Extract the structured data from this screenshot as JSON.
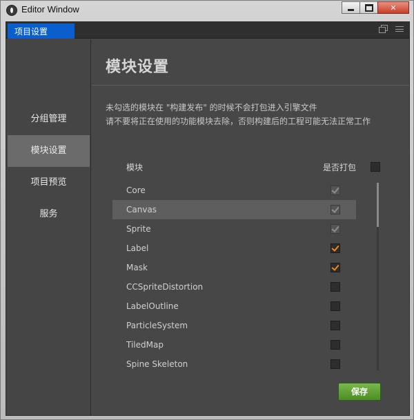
{
  "window": {
    "title": "Editor Window"
  },
  "tabbar": {
    "active_tab": "项目设置"
  },
  "sidebar": {
    "items": [
      {
        "label": "分组管理",
        "active": false
      },
      {
        "label": "模块设置",
        "active": true
      },
      {
        "label": "项目预览",
        "active": false
      },
      {
        "label": "服务",
        "active": false
      }
    ]
  },
  "main": {
    "title": "模块设置",
    "notice_line1": "未勾选的模块在 \"构建发布\" 的时候不会打包进入引擎文件",
    "notice_line2": "请不要将正在使用的功能模块去除，否则构建后的工程可能无法正常工作",
    "header_module": "模块",
    "header_pack": "是否打包",
    "header_pack_checked": false,
    "modules": [
      {
        "name": "Core",
        "state": "locked-checked"
      },
      {
        "name": "Canvas",
        "state": "locked-checked"
      },
      {
        "name": "Sprite",
        "state": "locked-checked"
      },
      {
        "name": "Label",
        "state": "checked"
      },
      {
        "name": "Mask",
        "state": "checked"
      },
      {
        "name": "CCSpriteDistortion",
        "state": "unchecked"
      },
      {
        "name": "LabelOutline",
        "state": "unchecked"
      },
      {
        "name": "ParticleSystem",
        "state": "unchecked"
      },
      {
        "name": "TiledMap",
        "state": "unchecked"
      },
      {
        "name": "Spine Skeleton",
        "state": "unchecked"
      }
    ],
    "hovered_module": "Canvas",
    "save_label": "保存"
  },
  "colors": {
    "accent_tab": "#0a5fcf",
    "check_orange": "#f08a1e",
    "save_green": "#5f9f34"
  }
}
